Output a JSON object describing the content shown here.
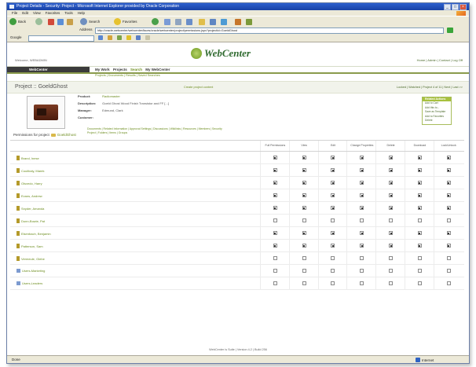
{
  "window": {
    "title": "Project Details - Security: Project - Microsoft Internet Explorer provided by Oracle Corporation"
  },
  "menubar": [
    "File",
    "Edit",
    "View",
    "Favorites",
    "Tools",
    "Help"
  ],
  "toolbar": {
    "back_label": "Back",
    "search_label": "Search",
    "favorites_label": "Favorites"
  },
  "address": {
    "label": "Address",
    "url": "http://oracle-webcenter/webcenter/faces/oracle/webcenter/project/permissions.jspx?projectId=GoeldGhost"
  },
  "linksbar": {
    "label": "Google",
    "search_placeholder": ""
  },
  "brand": {
    "logo_text": "WebCenter",
    "welcome": "Welcome, WEBADMIN",
    "top_links": "Home  |  Admin  |  Contact  |  Log Off"
  },
  "nav": {
    "section": "WebCenter",
    "primary": [
      "My Work",
      "Projects",
      "Search",
      "My WebCenter"
    ],
    "primary_active": "Search",
    "secondary": "Projects  |  Documents  |  Results  |  Saved Searches"
  },
  "project": {
    "title": "Project :: GoeldGhost",
    "mid_link": "Create project content",
    "right_links": "Locked  |  Watched  |  Project 4 of 11  |  Next  |  Last >>"
  },
  "details": {
    "fields": [
      {
        "label": "Product:",
        "value": "Radiomaster"
      },
      {
        "label": "Description:",
        "value": "Goeld Ghost Wood Finish Transistor and FF [...]"
      },
      {
        "label": "Manager:",
        "value": "Edmund, Clark"
      },
      {
        "label": "Customer:",
        "value": ""
      }
    ],
    "actions_title": "Related Actions",
    "actions": [
      "Add to Cart",
      "Add this to...",
      "Save as Template",
      "Add to Favorites",
      "Delete"
    ],
    "subtabs_line1": "Documents  |  Related Information  |  Approval Settings  |  Discussions  |  Wikilinks  |  Resources  |  Members  |  Security",
    "subtabs_line2": "Project  |  Folders  |  Items  |  Groups"
  },
  "permissions": {
    "title": "Permissions for project",
    "project_name": "GoeldGhost",
    "columns": [
      "Full Permissions",
      "View",
      "Edit",
      "Change Properties",
      "Delete",
      "Download",
      "Lock/Unlock"
    ],
    "rows": [
      {
        "name": "Brand, Inese",
        "type": "user",
        "perms": [
          true,
          true,
          true,
          true,
          true,
          true,
          true
        ]
      },
      {
        "name": "Coulibaly, Marek",
        "type": "user",
        "perms": [
          true,
          true,
          true,
          true,
          true,
          true,
          true
        ]
      },
      {
        "name": "Olsvedo, Harry",
        "type": "user",
        "perms": [
          true,
          true,
          true,
          true,
          true,
          true,
          true
        ]
      },
      {
        "name": "Evans, Andrew",
        "type": "user",
        "perms": [
          true,
          true,
          true,
          true,
          true,
          true,
          true
        ]
      },
      {
        "name": "Snyder, Amanda",
        "type": "user",
        "perms": [
          true,
          true,
          true,
          true,
          true,
          true,
          true
        ]
      },
      {
        "name": "Dunn-Bowie, Pat",
        "type": "user",
        "perms": [
          false,
          false,
          false,
          false,
          false,
          false,
          false
        ]
      },
      {
        "name": "Elsenbach, Benjamin",
        "type": "user",
        "perms": [
          true,
          true,
          true,
          true,
          true,
          true,
          true
        ]
      },
      {
        "name": "Patterson, Sam",
        "type": "user",
        "perms": [
          true,
          true,
          true,
          true,
          true,
          true,
          true
        ]
      },
      {
        "name": "Vermeule, Glebe",
        "type": "user",
        "perms": [
          false,
          false,
          false,
          false,
          false,
          false,
          false
        ]
      },
      {
        "name": "Users-Marketing",
        "type": "group",
        "perms": [
          false,
          false,
          false,
          false,
          false,
          false,
          false
        ]
      },
      {
        "name": "Users-Leaders",
        "type": "group",
        "perms": [
          false,
          false,
          false,
          false,
          false,
          false,
          false
        ]
      }
    ]
  },
  "footer": "WebCenter is Suite  |  Version 4.2  |  Build 256",
  "status": {
    "left": "Done",
    "zone": "Internet"
  },
  "colors": {
    "accent_green": "#6d8d1f",
    "title_blue": "#1941a5",
    "chrome": "#ece9d8"
  }
}
